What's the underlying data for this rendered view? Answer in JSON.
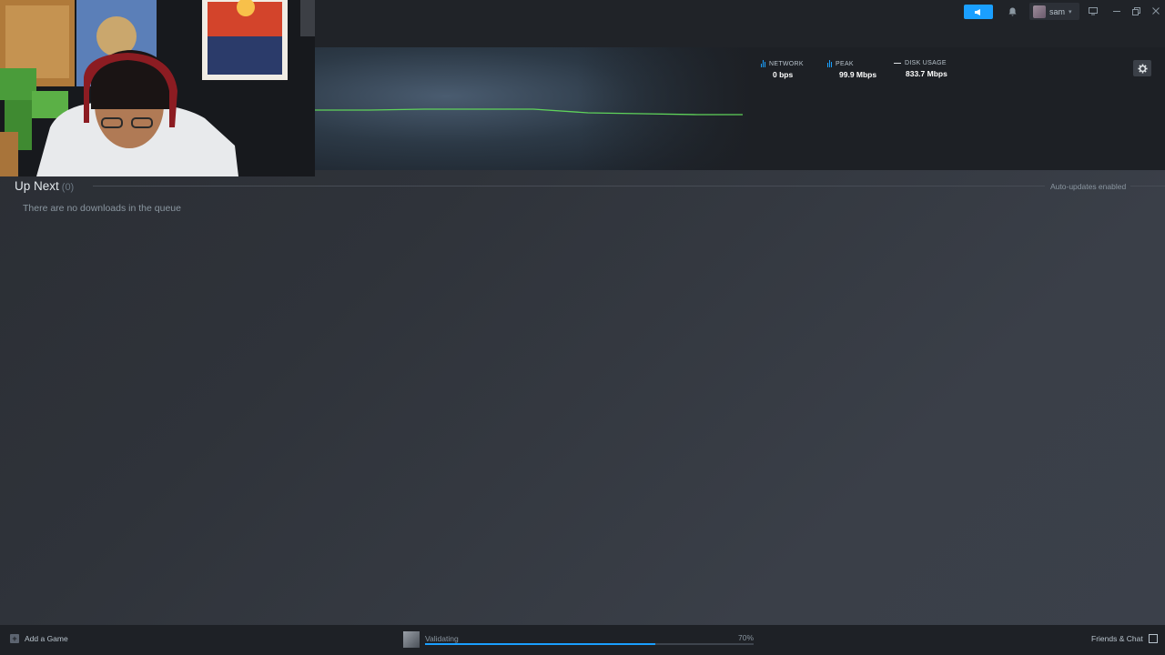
{
  "user": {
    "name": "sam"
  },
  "stats": {
    "network": {
      "label": "NETWORK",
      "value": "0 bps"
    },
    "peak": {
      "label": "PEAK",
      "value": "99.9 Mbps"
    },
    "disk": {
      "label": "DISK USAGE",
      "value": "833.7 Mbps"
    }
  },
  "up_next": {
    "title": "Up Next",
    "count": "(0)",
    "empty_message": "There are no downloads in the queue",
    "auto_updates": "Auto-updates enabled"
  },
  "bottom": {
    "add_game": "Add a Game",
    "status": "Validating",
    "percent_label": "70%",
    "progress": 0.7,
    "friends": "Friends & Chat"
  },
  "colors": {
    "accent": "#1a9fff",
    "graph_line": "#5fd35a"
  }
}
